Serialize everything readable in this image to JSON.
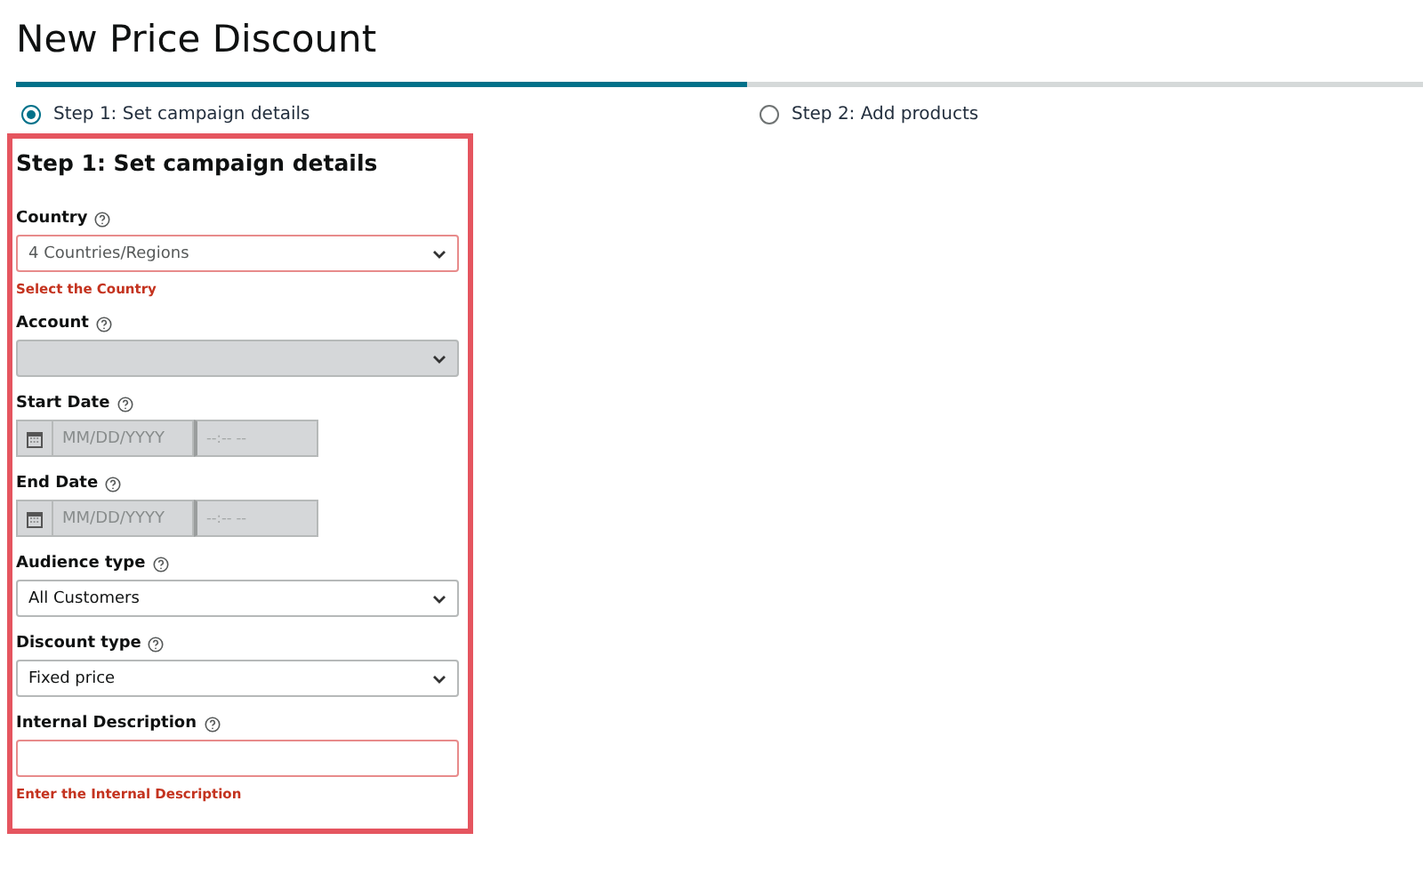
{
  "page": {
    "title": "New Price Discount"
  },
  "steps": [
    {
      "label": "Step 1: Set campaign details",
      "selected": true
    },
    {
      "label": "Step 2: Add products",
      "selected": false
    }
  ],
  "progress": {
    "level": 0.52
  },
  "form": {
    "heading": "Step 1: Set campaign details",
    "highlighted": true,
    "fields": [
      {
        "kind": "select",
        "label": "Country",
        "value": "4 Countries/Regions",
        "error": "Select the Country",
        "invalid": true,
        "disabled": false
      },
      {
        "kind": "select",
        "label": "Account",
        "invalid": false,
        "disabled": true
      },
      {
        "kind": "date",
        "label": "Start Date",
        "date_placeholder": "MM/DD/YYYY",
        "time_placeholder": "--:-- --"
      },
      {
        "kind": "date",
        "label": "End Date",
        "date_placeholder": "MM/DD/YYYY",
        "time_placeholder": "--:-- --"
      },
      {
        "kind": "select",
        "label": "Audience type",
        "value": "All Customers",
        "invalid": false,
        "disabled": false
      },
      {
        "kind": "select",
        "label": "Discount type",
        "value": "Fixed price",
        "invalid": false,
        "disabled": false
      },
      {
        "kind": "text",
        "label": "Internal Description",
        "error": "Enter the Internal Description",
        "invalid": true
      }
    ]
  }
}
